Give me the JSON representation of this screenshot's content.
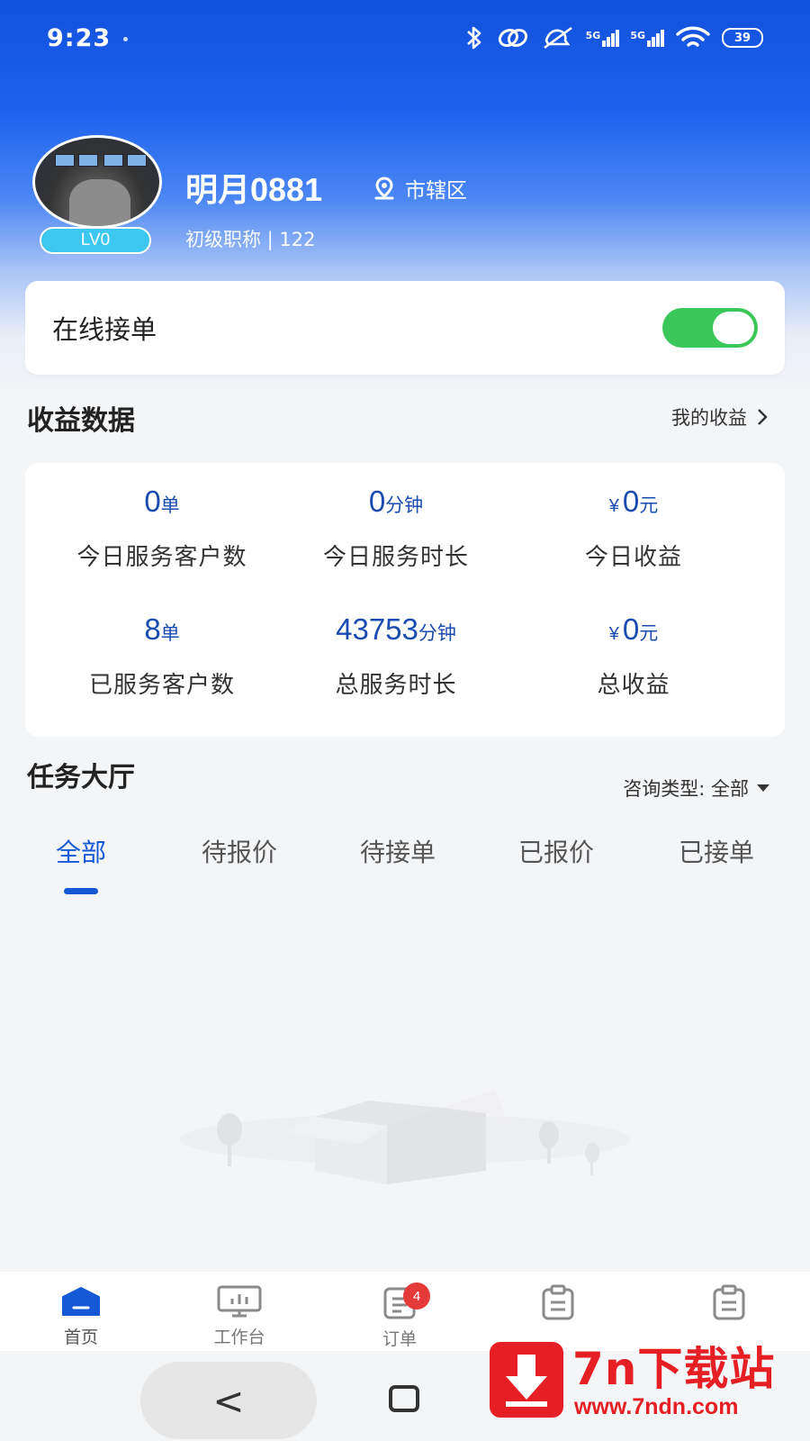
{
  "status_bar": {
    "time": "9:23",
    "network_label_1": "5G",
    "network_label_2": "5G",
    "battery": "39",
    "icons": [
      "bluetooth-icon",
      "link-icon",
      "mute-icon",
      "signal-icon",
      "wifi-icon",
      "battery-icon"
    ]
  },
  "profile": {
    "name": "明月0881",
    "location": "市辖区",
    "level": "LV0",
    "title_line": "初级职称 | 122"
  },
  "online": {
    "label": "在线接单",
    "enabled": true
  },
  "earnings": {
    "title": "收益数据",
    "link_label": "我的收益",
    "currency_symbol": "¥",
    "stats": [
      {
        "value": "0",
        "unit": "单",
        "label": "今日服务客户数"
      },
      {
        "value": "0",
        "unit": "分钟",
        "label": "今日服务时长"
      },
      {
        "value": "0",
        "unit": "元",
        "label": "今日收益"
      },
      {
        "value": "8",
        "unit": "单",
        "label": "已服务客户数"
      },
      {
        "value": "43753",
        "unit": "分钟",
        "label": "总服务时长"
      },
      {
        "value": "0",
        "unit": "元",
        "label": "总收益"
      }
    ]
  },
  "tasks": {
    "title": "任务大厅",
    "filter_label": "咨询类型: 全部",
    "tabs": [
      "全部",
      "待报价",
      "待接单",
      "已报价",
      "已接单"
    ],
    "active_tab": 0
  },
  "bottom_nav": {
    "items": [
      {
        "label": "首页",
        "icon": "home-icon",
        "active": true
      },
      {
        "label": "工作台",
        "icon": "monitor-icon"
      },
      {
        "label": "订单",
        "icon": "order-icon",
        "badge": "4"
      },
      {
        "label": "",
        "icon": "clipboard-icon"
      },
      {
        "label": "",
        "icon": "clipboard-icon"
      }
    ]
  },
  "system_nav": {
    "back_glyph": "<"
  },
  "watermark": {
    "title": "7n下载站",
    "url": "www.7ndn.com"
  },
  "colors": {
    "primary": "#1458d6",
    "value_text": "#1a4bb0",
    "toggle_on": "#3cc75a",
    "badge": "#e43a3a",
    "level_badge": "#3cc7f0",
    "watermark_red": "#e51f24"
  }
}
